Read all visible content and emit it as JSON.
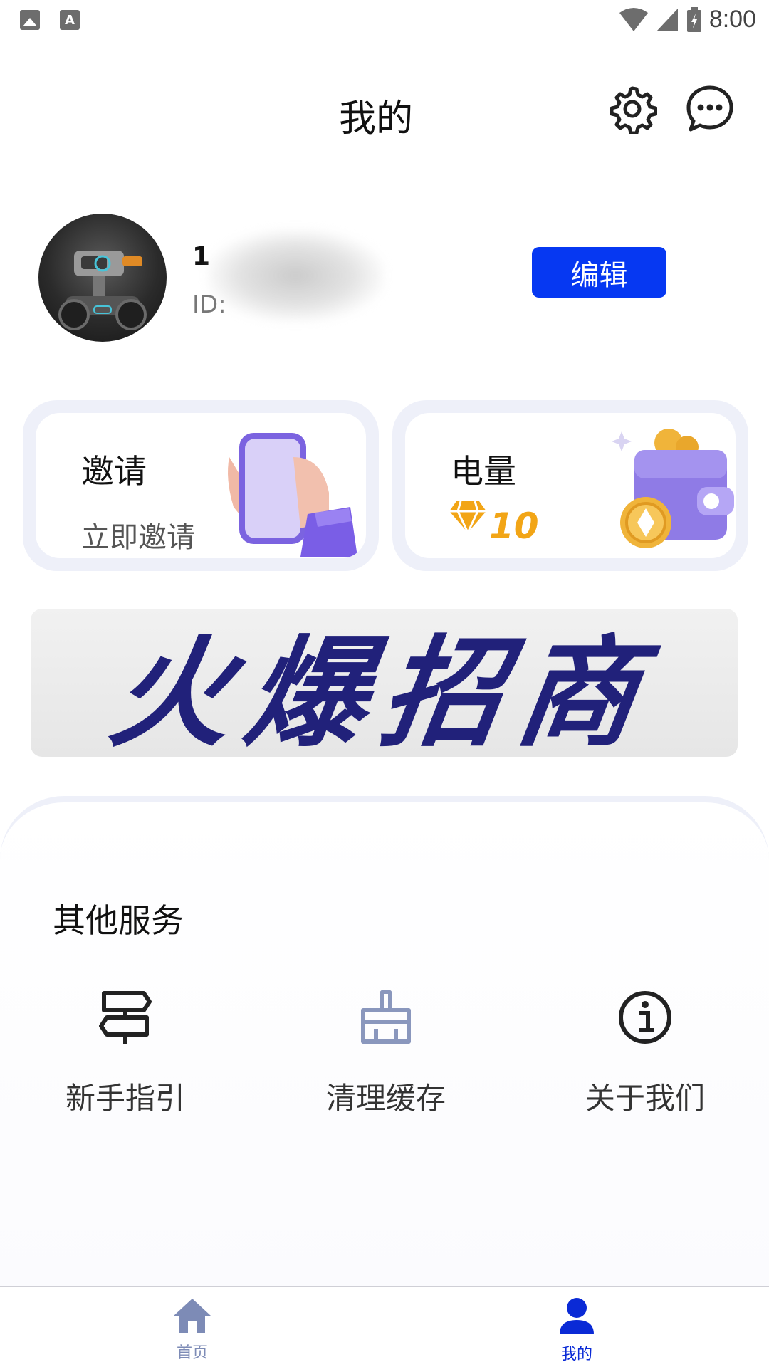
{
  "status_bar": {
    "time": "8:00",
    "left_icons": [
      "image-icon",
      "font-a-icon"
    ],
    "right_icons": [
      "wifi-icon",
      "cellular-icon",
      "battery-icon"
    ]
  },
  "header": {
    "title": "我的",
    "icons": [
      "settings-icon",
      "message-icon"
    ]
  },
  "profile": {
    "name_visible": "1",
    "id_label": "ID:",
    "edit_label": "编辑"
  },
  "cards": {
    "invite": {
      "title": "邀请",
      "subtitle": "立即邀请",
      "illustration": "phone-hand-illustration"
    },
    "power": {
      "title": "电量",
      "value": "10",
      "icon": "diamond-icon",
      "illustration": "wallet-coin-illustration"
    }
  },
  "banner": {
    "text": "火爆招商"
  },
  "services": {
    "title": "其他服务",
    "items": [
      {
        "label": "新手指引",
        "icon": "signpost-icon"
      },
      {
        "label": "清理缓存",
        "icon": "broom-icon"
      },
      {
        "label": "关于我们",
        "icon": "info-icon"
      }
    ]
  },
  "bottom_nav": {
    "items": [
      {
        "label": "首页",
        "icon": "home-icon",
        "active": false
      },
      {
        "label": "我的",
        "icon": "user-icon",
        "active": true
      }
    ]
  },
  "colors": {
    "accent": "#0638f2",
    "nav_active": "#0a2ad6",
    "nav_inactive": "#7d8bb6",
    "gold": "#f2a516"
  }
}
